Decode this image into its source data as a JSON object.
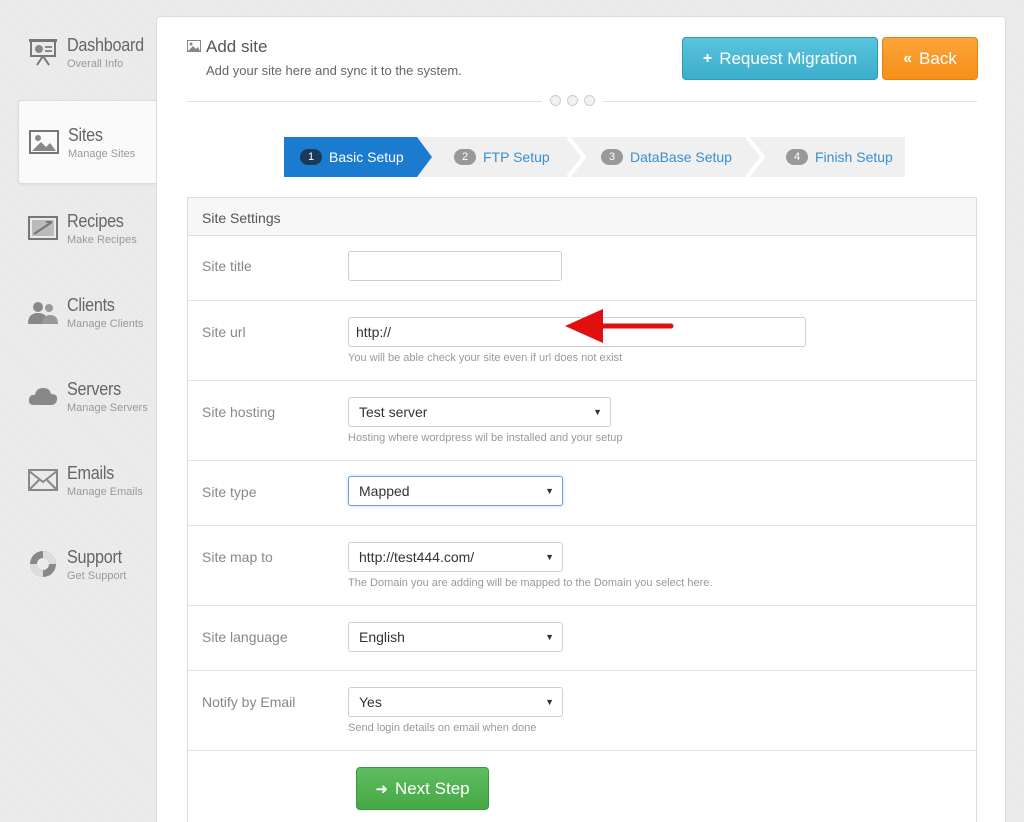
{
  "sidebar": {
    "items": [
      {
        "title": "Dashboard",
        "sub": "Overall Info",
        "icon": "presentation-icon"
      },
      {
        "title": "Sites",
        "sub": "Manage Sites",
        "icon": "image-icon"
      },
      {
        "title": "Recipes",
        "sub": "Make Recipes",
        "icon": "recipe-icon"
      },
      {
        "title": "Clients",
        "sub": "Manage Clients",
        "icon": "users-icon"
      },
      {
        "title": "Servers",
        "sub": "Manage Servers",
        "icon": "cloud-icon"
      },
      {
        "title": "Emails",
        "sub": "Manage Emails",
        "icon": "envelope-icon"
      },
      {
        "title": "Support",
        "sub": "Get Support",
        "icon": "lifebuoy-icon"
      }
    ],
    "active_index": 1
  },
  "header": {
    "title": "Add site",
    "subtitle": "Add your site here and sync it to the system.",
    "migrate_label": "Request Migration",
    "migrate_glyph": "+",
    "back_label": "Back",
    "back_glyph": "«"
  },
  "wizard": {
    "steps": [
      {
        "num": "1",
        "label": "Basic Setup"
      },
      {
        "num": "2",
        "label": "FTP Setup"
      },
      {
        "num": "3",
        "label": "DataBase Setup"
      },
      {
        "num": "4",
        "label": "Finish Setup"
      }
    ],
    "active_index": 0
  },
  "form": {
    "heading": "Site Settings",
    "fields": {
      "title": {
        "label": "Site title",
        "value": ""
      },
      "url": {
        "label": "Site url",
        "value": "http://",
        "help": "You will be able check your site even if url does not exist"
      },
      "hosting": {
        "label": "Site hosting",
        "value": "Test server",
        "help": "Hosting where wordpress wil be installed and your setup"
      },
      "type": {
        "label": "Site type",
        "value": "Mapped"
      },
      "map_to": {
        "label": "Site map to",
        "value": "http://test444.com/",
        "help": "The Domain you are adding will be mapped to the Domain you select here."
      },
      "language": {
        "label": "Site language",
        "value": "English"
      },
      "notify": {
        "label": "Notify by Email",
        "value": "Yes",
        "help": "Send login details on email when done"
      }
    },
    "next_label": "Next Step",
    "next_glyph": "➜"
  },
  "colors": {
    "accent_blue": "#1a7bcf",
    "migrate": "#3aaecc",
    "back": "#f5901a",
    "next": "#45a845",
    "annotation": "#e01010"
  }
}
